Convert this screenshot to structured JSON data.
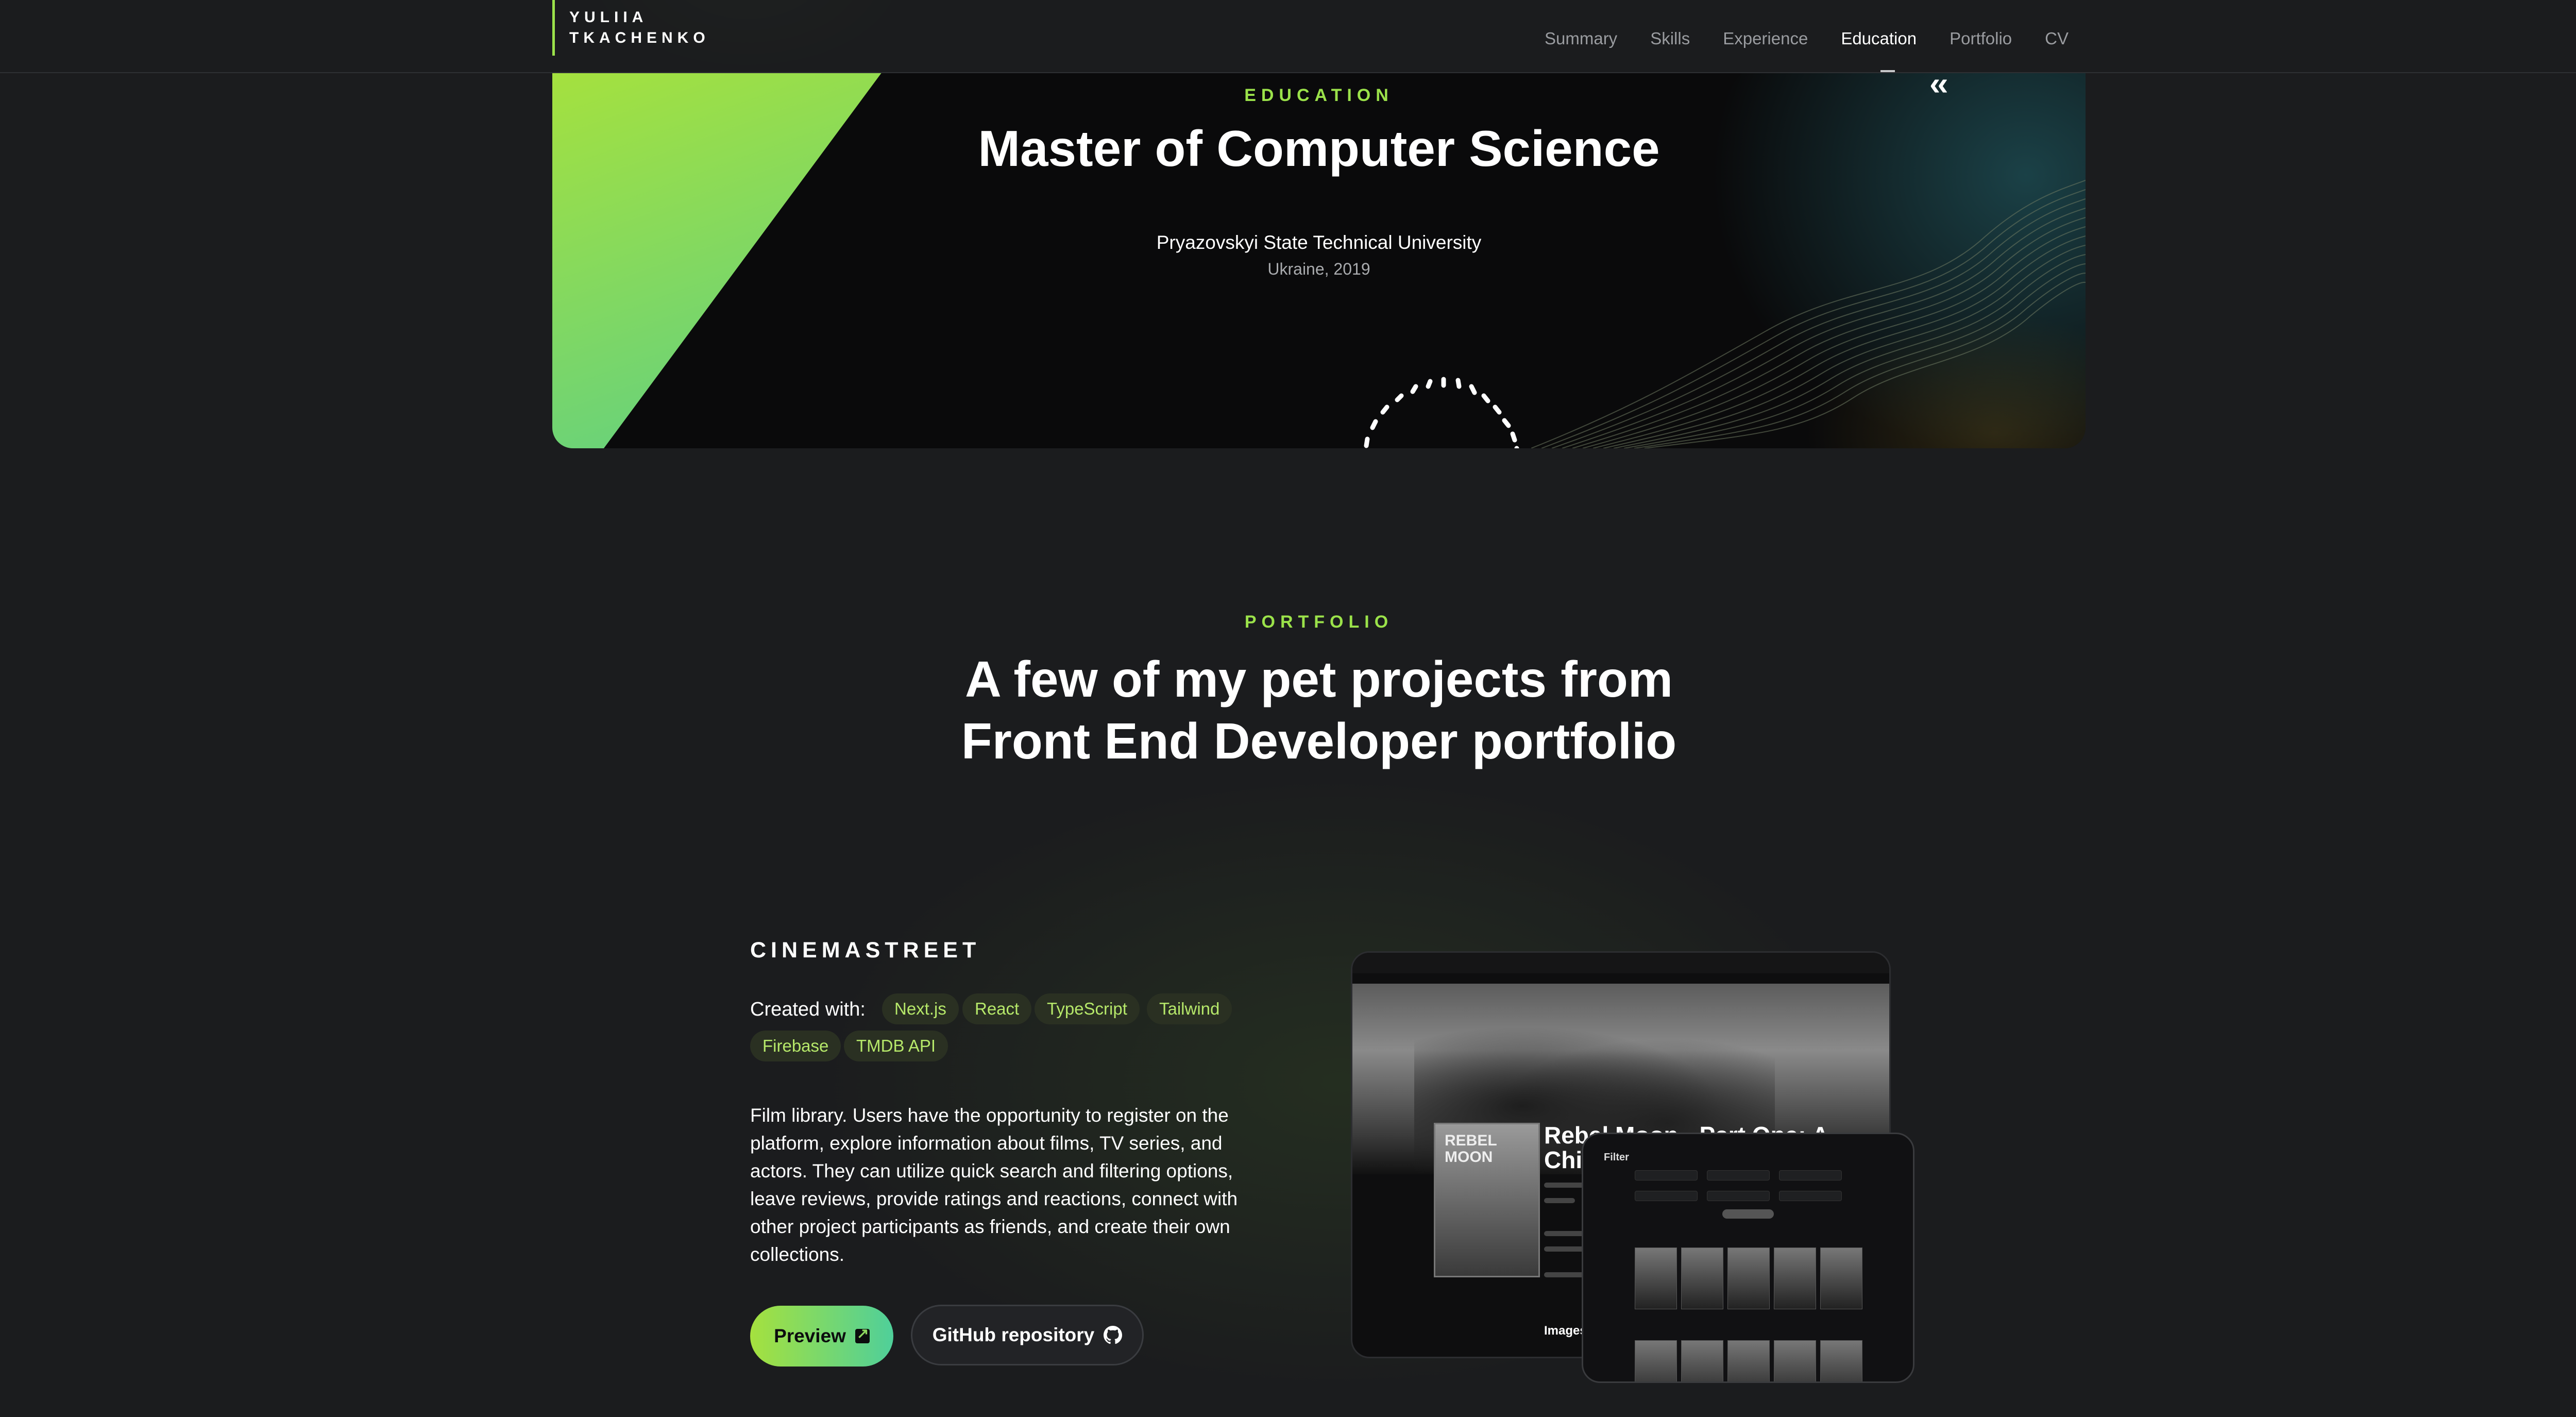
{
  "header": {
    "logo_line1": "YULIIA",
    "logo_line2": "TKACHENKO",
    "nav": [
      {
        "label": "Summary"
      },
      {
        "label": "Skills"
      },
      {
        "label": "Experience"
      },
      {
        "label": "Education",
        "active": true
      },
      {
        "label": "Portfolio"
      },
      {
        "label": "CV"
      }
    ]
  },
  "education": {
    "eyebrow": "EDUCATION",
    "degree": "Master of Computer Science",
    "university": "Pryazovskyi State Technical University",
    "location_year": "Ukraine, 2019",
    "prev_icon": "double-chevron-left-icon"
  },
  "portfolio": {
    "eyebrow": "PORTFOLIO",
    "title_line1": "A few of my pet projects from",
    "title_line2": "Front End Developer portfolio",
    "project": {
      "name": "CINEMASTREET",
      "created_label": "Created with:",
      "tags": [
        "Next.js",
        "React",
        "TypeScript",
        "Tailwind",
        "Firebase",
        "TMDB API"
      ],
      "description": "Film library. Users have the opportunity to register on the platform, explore information about films, TV series, and actors. They can utilize quick search and filtering options, leave reviews, provide ratings and reactions, connect with other project participants as friends, and create their own collections.",
      "preview_label": "Preview",
      "github_label": "GitHub repository",
      "mockup": {
        "poster_text": "REBEL MOON",
        "movie_title_line1": "Rebel Moon - Part One: A",
        "movie_title_line2": "Chil",
        "images_label": "Images",
        "filter_label": "Filter"
      }
    }
  },
  "colors": {
    "accent": "#9be24a",
    "accent_gradient_end": "#4fcf9a",
    "background": "#1b1c1e"
  }
}
